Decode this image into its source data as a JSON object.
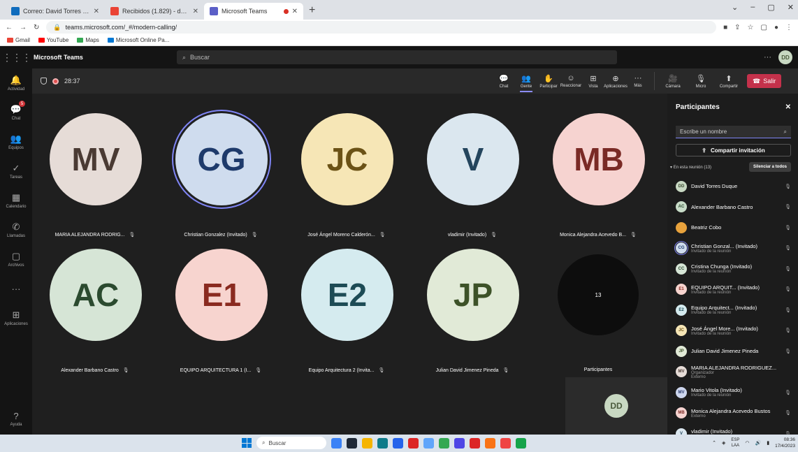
{
  "browser": {
    "tabs": [
      {
        "title": "Correo: David Torres Duque - Ou",
        "fav_color": "#0f6cbd",
        "active": false,
        "recording": false
      },
      {
        "title": "Recibidos (1.829) - davidtorresd",
        "fav_color": "#ea4335",
        "active": false,
        "recording": false
      },
      {
        "title": "Microsoft Teams",
        "fav_color": "#5b5fc7",
        "active": true,
        "recording": true
      }
    ],
    "new_tab": "+",
    "window_controls": [
      "⌄",
      "–",
      "▢",
      "✕"
    ],
    "url": "teams.microsoft.com/_#/modern-calling/",
    "bookmarks": [
      {
        "label": "Gmail",
        "color": "#ea4335"
      },
      {
        "label": "YouTube",
        "color": "#ff0000"
      },
      {
        "label": "Maps",
        "color": "#34a853"
      },
      {
        "label": "Microsoft Online Pa...",
        "color": "#0078d4"
      }
    ]
  },
  "teams": {
    "app_title": "Microsoft Teams",
    "search_placeholder": "Buscar",
    "more": "···",
    "me_initials": "DD",
    "rail": [
      {
        "name": "activity",
        "label": "Actividad",
        "glyph": "🔔",
        "badge": ""
      },
      {
        "name": "chat",
        "label": "Chat",
        "glyph": "💬",
        "badge": "5"
      },
      {
        "name": "teams",
        "label": "Equipos",
        "glyph": "👥",
        "badge": ""
      },
      {
        "name": "tasks",
        "label": "Tareas",
        "glyph": "✓",
        "badge": ""
      },
      {
        "name": "calendar",
        "label": "Calendario",
        "glyph": "▦",
        "badge": ""
      },
      {
        "name": "calls",
        "label": "Llamadas",
        "glyph": "✆",
        "badge": ""
      },
      {
        "name": "files",
        "label": "Archivos",
        "glyph": "▢",
        "badge": ""
      },
      {
        "name": "more",
        "label": "",
        "glyph": "···",
        "badge": ""
      },
      {
        "name": "apps",
        "label": "Aplicaciones",
        "glyph": "⊞",
        "badge": ""
      }
    ],
    "help_label": "Ayuda"
  },
  "meeting": {
    "timer": "28:37",
    "toolbar": [
      {
        "name": "chat",
        "label": "Chat",
        "glyph": "💬",
        "active": false
      },
      {
        "name": "people",
        "label": "Gente",
        "glyph": "👥",
        "active": true
      },
      {
        "name": "raise-hand",
        "label": "Participar",
        "glyph": "✋",
        "active": false
      },
      {
        "name": "react",
        "label": "Reaccionar",
        "glyph": "☺",
        "active": false
      },
      {
        "name": "view",
        "label": "Vista",
        "glyph": "⊞",
        "active": false
      },
      {
        "name": "apps",
        "label": "Aplicaciones",
        "glyph": "⊕",
        "active": false
      },
      {
        "name": "more",
        "label": "Más",
        "glyph": "···",
        "active": false
      }
    ],
    "media": [
      {
        "name": "camera",
        "label": "Cámara",
        "glyph": "🎥"
      },
      {
        "name": "mic",
        "label": "Micro",
        "glyph": "🎙"
      },
      {
        "name": "share",
        "label": "Compartir",
        "glyph": "⬆"
      }
    ],
    "leave_label": "Salir",
    "tiles": [
      {
        "initials": "MV",
        "name": "MARIA ALEJANDRA RODRIG...",
        "bg": "#e6dcd7",
        "fg": "#4a3a33",
        "speaking": false
      },
      {
        "initials": "CG",
        "name": "Christian Gonzalez (Invitado)",
        "bg": "#cfdcee",
        "fg": "#1e3a6b",
        "speaking": true
      },
      {
        "initials": "JC",
        "name": "José Ángel Moreno Calderón...",
        "bg": "#f6e6b6",
        "fg": "#6b5216",
        "speaking": false
      },
      {
        "initials": "V",
        "name": "vladimir (Invitado)",
        "bg": "#dbe7ef",
        "fg": "#24455d",
        "speaking": false
      },
      {
        "initials": "MB",
        "name": "Monica Alejandra Acevedo B...",
        "bg": "#f6d3d0",
        "fg": "#7a2a25",
        "speaking": false
      },
      {
        "initials": "AC",
        "name": "Alexander Barbano Castro",
        "bg": "#d6e5d6",
        "fg": "#2b4a2f",
        "speaking": false
      },
      {
        "initials": "E1",
        "name": "EQUIPO ARQUITECTURA 1 (I...",
        "bg": "#f7d4cf",
        "fg": "#8a2a20",
        "speaking": false
      },
      {
        "initials": "E2",
        "name": "Equipo Arquitectura 2 (Invita...",
        "bg": "#d5ebef",
        "fg": "#1d4b55",
        "speaking": false
      },
      {
        "initials": "JP",
        "name": "Julian David Jimenez Pineda",
        "bg": "#e1ead7",
        "fg": "#3d5228",
        "speaking": false
      }
    ],
    "overflow": {
      "count": "13",
      "label": "Participantes"
    },
    "self_initials": "DD"
  },
  "participants_panel": {
    "title": "Participantes",
    "search_placeholder": "Escribe un nombre",
    "share_invite": "Compartir invitación",
    "in_meeting": "En esta reunión (13)",
    "mute_all": "Silenciar a todos",
    "people": [
      {
        "initials": "DD",
        "name": "David Torres Duque",
        "sub": "",
        "sub2": "",
        "bg": "#c8d8c2",
        "fg": "#3d4d33",
        "mic": "🎙",
        "selected": false
      },
      {
        "initials": "AC",
        "name": "Alexander Barbano Castro",
        "sub": "",
        "sub2": "",
        "bg": "#c8dcc8",
        "fg": "#2b4a2f",
        "mic": "🎙",
        "selected": false
      },
      {
        "initials": "",
        "name": "Beatriz Cobo",
        "sub": "",
        "sub2": "",
        "bg": "#e8a23c",
        "fg": "#ffffff",
        "mic": "🎙",
        "selected": false
      },
      {
        "initials": "CG",
        "name": "Christian Gonzal... (Invitado)",
        "sub": "Invitado de la reunión",
        "sub2": "",
        "bg": "#cfdcee",
        "fg": "#1e3a6b",
        "mic": "🎙",
        "selected": true
      },
      {
        "initials": "CC",
        "name": "Cristina Chunga (Invitado)",
        "sub": "Invitado de la reunión",
        "sub2": "",
        "bg": "#d6e5d6",
        "fg": "#2b4a2f",
        "mic": "🎙",
        "selected": false
      },
      {
        "initials": "E1",
        "name": "EQUIPO ARQUIT... (Invitado)",
        "sub": "Invitado de la reunión",
        "sub2": "",
        "bg": "#f7d4cf",
        "fg": "#8a2a20",
        "mic": "🎙",
        "selected": false
      },
      {
        "initials": "E2",
        "name": "Equipo Arquitect... (Invitado)",
        "sub": "Invitado de la reunión",
        "sub2": "",
        "bg": "#d5ebef",
        "fg": "#1d4b55",
        "mic": "🎙",
        "selected": false
      },
      {
        "initials": "JC",
        "name": "José Ángel More... (Invitado)",
        "sub": "Invitado de la reunión",
        "sub2": "",
        "bg": "#f6e6b6",
        "fg": "#6b5216",
        "mic": "🎙",
        "selected": false
      },
      {
        "initials": "JP",
        "name": "Julian David Jimenez Pineda",
        "sub": "",
        "sub2": "",
        "bg": "#e1ead7",
        "fg": "#3d5228",
        "mic": "🎙",
        "selected": false
      },
      {
        "initials": "MV",
        "name": "MARIA ALEJANDRA RODRIGUEZ...",
        "sub": "Organizador",
        "sub2": "Externo",
        "bg": "#e6dcd7",
        "fg": "#4a3a33",
        "mic": "",
        "selected": false
      },
      {
        "initials": "MV",
        "name": "Mario Vitola (Invitado)",
        "sub": "Invitado de la reunión",
        "sub2": "",
        "bg": "#cdd6ee",
        "fg": "#2a3a6b",
        "mic": "🎙",
        "selected": false
      },
      {
        "initials": "MB",
        "name": "Monica Alejandra Acevedo Bustos",
        "sub": "Externo",
        "sub2": "",
        "bg": "#f6d3d0",
        "fg": "#7a2a25",
        "mic": "🎙",
        "selected": false
      },
      {
        "initials": "V",
        "name": "vladimir (Invitado)",
        "sub": "Invitado de la reunión",
        "sub2": "",
        "bg": "#dbe7ef",
        "fg": "#24455d",
        "mic": "🎙",
        "selected": false
      }
    ]
  },
  "taskbar": {
    "search_placeholder": "Buscar",
    "apps": [
      "#3b82f6",
      "#1f2937",
      "#f5b400",
      "#0f7b8a",
      "#2563eb",
      "#dc2626",
      "#60a5fa",
      "#34a853",
      "#4f46e5",
      "#dc2626",
      "#f97316",
      "#ef4444",
      "#16a34a"
    ],
    "lang_top": "ESP",
    "lang_bottom": "LAA",
    "time": "08:36",
    "date": "17/4/2023"
  },
  "colors": {
    "accent": "#7f85f5",
    "leave": "#c4314b",
    "recording": "#e04f4f"
  }
}
